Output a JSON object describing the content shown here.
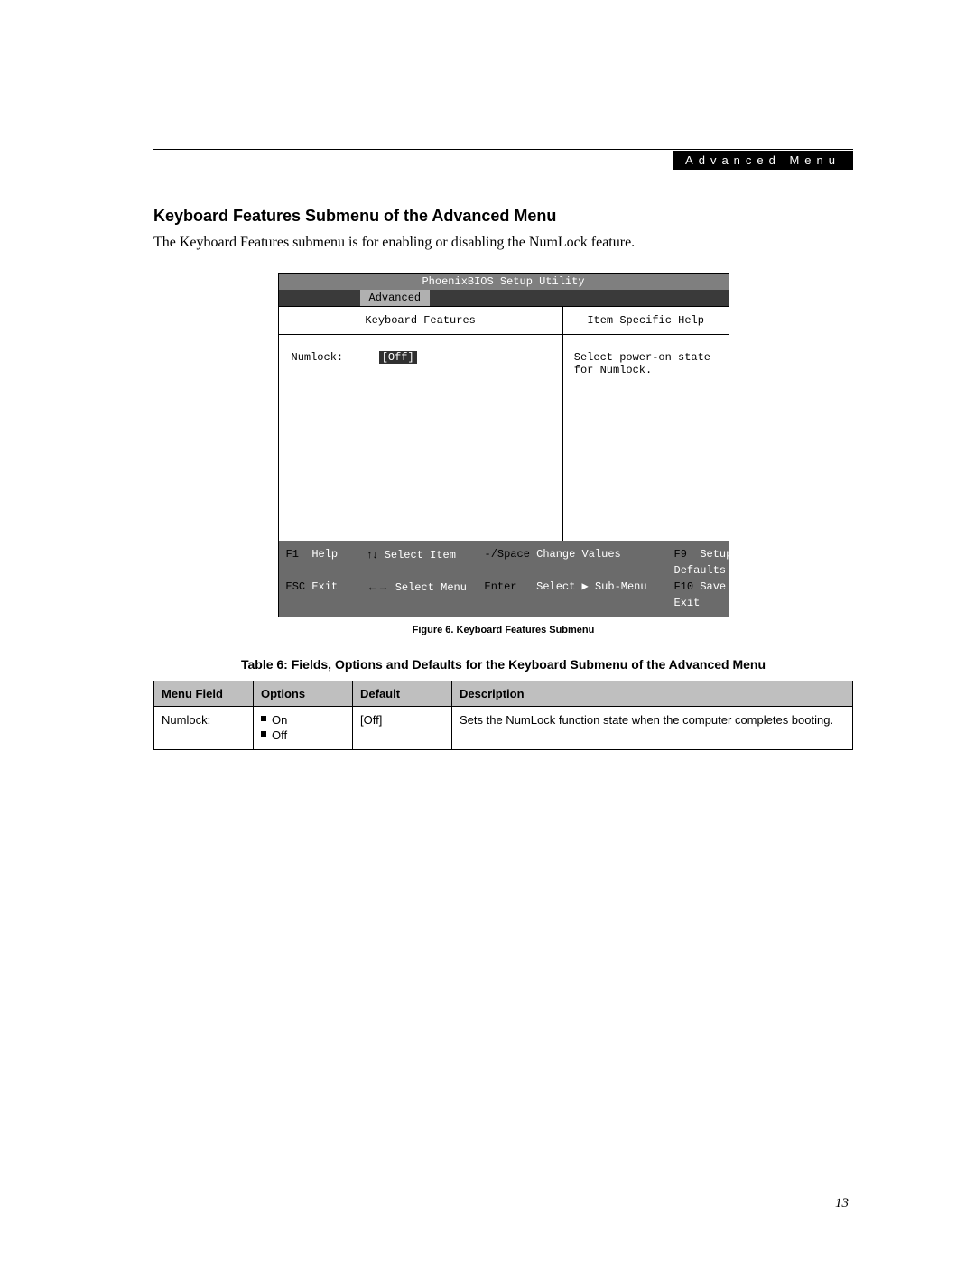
{
  "header": {
    "menu": "Advanced Menu"
  },
  "section": {
    "title": "Keyboard Features Submenu of the Advanced Menu",
    "body": "The Keyboard Features submenu is for enabling or disabling the NumLock feature."
  },
  "bios": {
    "utility_title": "PhoenixBIOS Setup Utility",
    "active_tab": "Advanced",
    "left_heading": "Keyboard Features",
    "right_heading": "Item Specific Help",
    "setting_label": "Numlock:",
    "setting_value": "[Off]",
    "help_text_1": "Select power-on state",
    "help_text_2": "for Numlock.",
    "footer": {
      "f1_key": "F1",
      "f1_label": "Help",
      "arrows_ud": "↑↓",
      "select_item": "Select Item",
      "minus_space": "-/Space",
      "change_values": "Change Values",
      "f9_key": "F9",
      "f9_label": "Setup Defaults",
      "esc_key": "ESC",
      "esc_label": "Exit",
      "arrows_lr": "←→",
      "select_menu": "Select Menu",
      "enter_key": "Enter",
      "select_sub": "Select ▶ Sub-Menu",
      "f10_key": "F10",
      "f10_label": "Save and Exit"
    }
  },
  "figure_caption": "Figure 6.  Keyboard Features Submenu",
  "table_caption": "Table 6: Fields, Options and Defaults for the Keyboard Submenu of the Advanced Menu",
  "table": {
    "headers": {
      "field": "Menu Field",
      "options": "Options",
      "default": "Default",
      "description": "Description"
    },
    "row": {
      "field": "Numlock:",
      "option1": "On",
      "option2": "Off",
      "default": "[Off]",
      "description": "Sets the NumLock function state when the computer completes booting."
    }
  },
  "page_number": "13"
}
